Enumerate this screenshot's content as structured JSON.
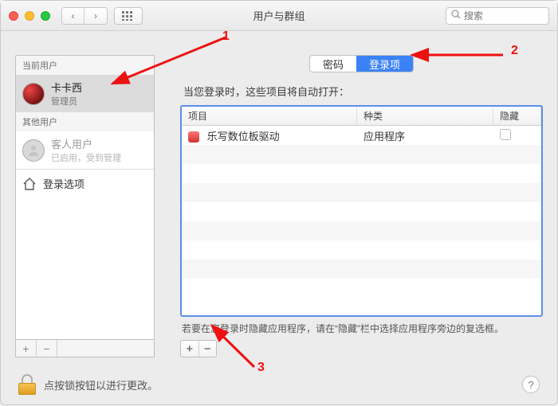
{
  "window": {
    "title": "用户与群组",
    "search_placeholder": "搜索"
  },
  "sidebar": {
    "current_label": "当前用户",
    "other_label": "其他用户",
    "users": [
      {
        "name": "卡卡西",
        "role": "管理员"
      },
      {
        "name": "客人用户",
        "role": "已启用，受到管理"
      }
    ],
    "login_options": "登录选项"
  },
  "tabs": {
    "password": "密码",
    "login_items": "登录项"
  },
  "main": {
    "desc": "当您登录时，这些项目将自动打开：",
    "columns": {
      "item": "项目",
      "kind": "种类",
      "hide": "隐藏"
    },
    "rows": [
      {
        "name": "乐写数位板驱动",
        "kind": "应用程序",
        "hide": false
      }
    ],
    "hint": "若要在您登录时隐藏应用程序，请在“隐藏”栏中选择应用程序旁边的复选框。"
  },
  "footer": {
    "lock_text": "点按锁按钮以进行更改。"
  },
  "annotations": {
    "n1": "1",
    "n2": "2",
    "n3": "3"
  }
}
